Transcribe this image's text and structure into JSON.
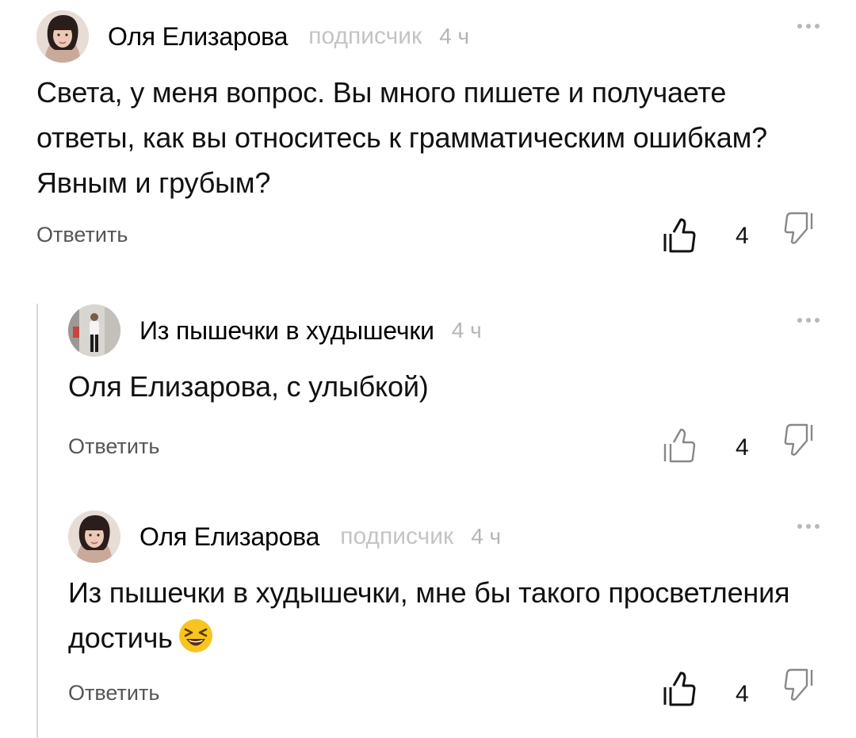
{
  "comments": [
    {
      "author": "Оля Елизарова",
      "role": "подписчик",
      "time": "4 ч",
      "text": "Света, у меня вопрос. Вы много пишете и получаете ответы, как вы относитесь к грамматическим ошибкам? Явным и грубым?",
      "reply_label": "Ответить",
      "likes": "4"
    },
    {
      "author": "Из пышечки в худышечки",
      "time": "4 ч",
      "text": "Оля Елизарова, с улыбкой)",
      "reply_label": "Ответить",
      "likes": "4"
    },
    {
      "author": "Оля Елизарова",
      "role": "подписчик",
      "time": "4 ч",
      "text": "Из пышечки в худышечки, мне бы такого просветления достичь",
      "emoji": "laughing-squinting-face",
      "reply_label": "Ответить",
      "likes": "4"
    }
  ],
  "icons": {
    "like": "thumbs-up-outline-icon",
    "dislike": "thumbs-down-outline-icon",
    "more": "more-dots-icon"
  },
  "colors": {
    "secondary_text": "#c4c4c4",
    "thread_line": "#d9d9d9",
    "emoji_yellow": "#f7c51e"
  }
}
